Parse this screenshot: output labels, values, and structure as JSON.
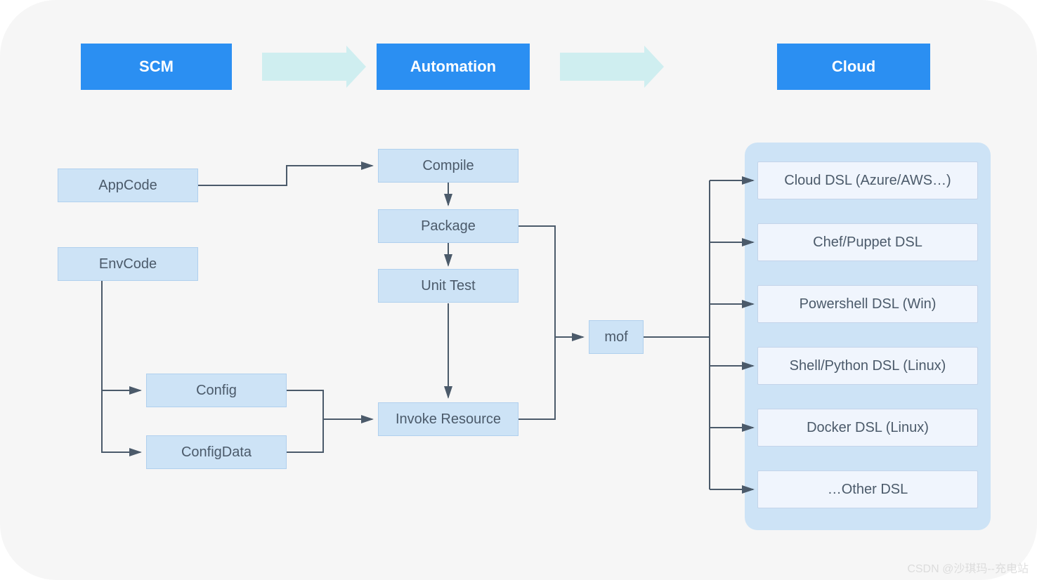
{
  "headers": {
    "scm": "SCM",
    "automation": "Automation",
    "cloud": "Cloud"
  },
  "scm": {
    "appcode": "AppCode",
    "envcode": "EnvCode",
    "config": "Config",
    "configdata": "ConfigData"
  },
  "automation": {
    "compile": "Compile",
    "package": "Package",
    "unittest": "Unit Test",
    "invoke": "Invoke Resource",
    "mof": "mof"
  },
  "cloud": {
    "items": [
      "Cloud DSL (Azure/AWS…)",
      "Chef/Puppet DSL",
      "Powershell DSL (Win)",
      "Shell/Python DSL (Linux)",
      "Docker DSL (Linux)",
      "…Other DSL"
    ]
  },
  "watermark": "CSDN @沙琪玛--充电站"
}
